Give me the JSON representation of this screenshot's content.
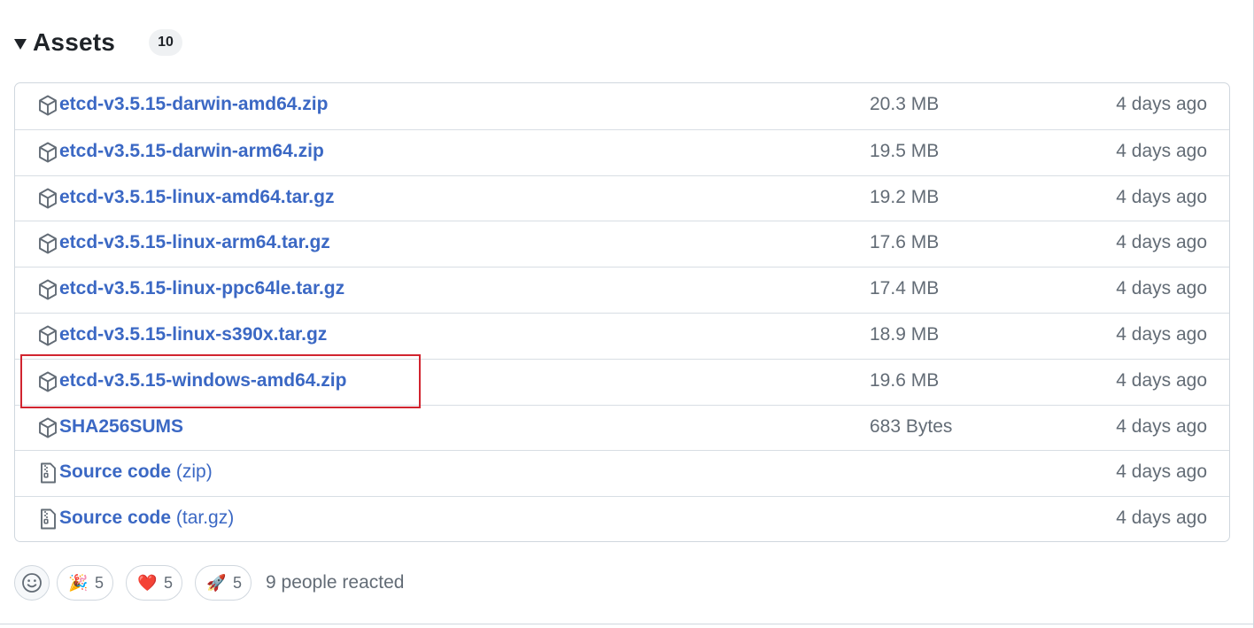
{
  "assets_header": {
    "title": "Assets",
    "count": "10"
  },
  "assets": [
    {
      "name": "etcd-v3.5.15-darwin-amd64.zip",
      "suffix": "",
      "size": "20.3 MB",
      "date": "4 days ago",
      "icon": "package-icon"
    },
    {
      "name": "etcd-v3.5.15-darwin-arm64.zip",
      "suffix": "",
      "size": "19.5 MB",
      "date": "4 days ago",
      "icon": "package-icon"
    },
    {
      "name": "etcd-v3.5.15-linux-amd64.tar.gz",
      "suffix": "",
      "size": "19.2 MB",
      "date": "4 days ago",
      "icon": "package-icon"
    },
    {
      "name": "etcd-v3.5.15-linux-arm64.tar.gz",
      "suffix": "",
      "size": "17.6 MB",
      "date": "4 days ago",
      "icon": "package-icon"
    },
    {
      "name": "etcd-v3.5.15-linux-ppc64le.tar.gz",
      "suffix": "",
      "size": "17.4 MB",
      "date": "4 days ago",
      "icon": "package-icon"
    },
    {
      "name": "etcd-v3.5.15-linux-s390x.tar.gz",
      "suffix": "",
      "size": "18.9 MB",
      "date": "4 days ago",
      "icon": "package-icon"
    },
    {
      "name": "etcd-v3.5.15-windows-amd64.zip",
      "suffix": "",
      "size": "19.6 MB",
      "date": "4 days ago",
      "icon": "package-icon"
    },
    {
      "name": "SHA256SUMS",
      "suffix": "",
      "size": "683 Bytes",
      "date": "4 days ago",
      "icon": "package-icon"
    },
    {
      "name": "Source code",
      "suffix": " (zip)",
      "size": "",
      "date": "4 days ago",
      "icon": "file-zip-icon"
    },
    {
      "name": "Source code",
      "suffix": " (tar.gz)",
      "size": "",
      "date": "4 days ago",
      "icon": "file-zip-icon"
    }
  ],
  "reactions": {
    "items": [
      {
        "emoji": "🎉",
        "count": "5",
        "icon": "tada-icon"
      },
      {
        "emoji": "❤️",
        "count": "5",
        "icon": "heart-icon"
      },
      {
        "emoji": "🚀",
        "count": "5",
        "icon": "rocket-icon"
      }
    ],
    "summary": "9 people reacted"
  },
  "colors": {
    "link": "#3b68c4",
    "muted": "#636c76",
    "border": "#d0d7de",
    "highlight": "#d1242f"
  }
}
